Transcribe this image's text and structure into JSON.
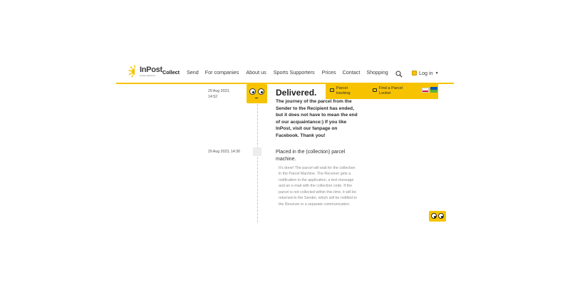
{
  "header": {
    "logo": {
      "word": "InPost",
      "tagline": "simply deliveries"
    },
    "nav": [
      {
        "label": "Collect",
        "active": true
      },
      {
        "label": "Send",
        "active": false
      },
      {
        "label": "For companies",
        "active": false
      },
      {
        "label": "About us",
        "active": false
      },
      {
        "label": "Sports Supporters",
        "active": false
      },
      {
        "label": "Prices",
        "active": false
      },
      {
        "label": "Contact",
        "active": false
      },
      {
        "label": "Shopping",
        "active": false
      }
    ],
    "login_label": "Log in",
    "search_icon": "search-icon",
    "accent_color": "#f7c300"
  },
  "subbar": {
    "parcel_tracking": "Parcel tracking",
    "find_locker": "Find a Parcel Locker",
    "languages": [
      "pl",
      "ua"
    ]
  },
  "events": [
    {
      "date": "29 Aug 2023,",
      "time": "14:52",
      "title": "Delivered.",
      "description": "The journey of the parcel from the Sender to the Recipient has ended, but it does not have to mean the end of our acquaintance:) If you like InPost, visit our fanpage on Facebook. Thank you!"
    },
    {
      "date": "29 Aug 2023, 14:36",
      "title": "Placed in the (collection) parcel machine.",
      "description": "It's done! The parcel will wait for the collection in the Parcel Machine. The Receiver gets a notification in the application, a text message and an e-mail with the collection code. If the parcel is not collected within this time, it will be returned to the Sender, which will be notified to the Receiver in a separate communication."
    }
  ]
}
